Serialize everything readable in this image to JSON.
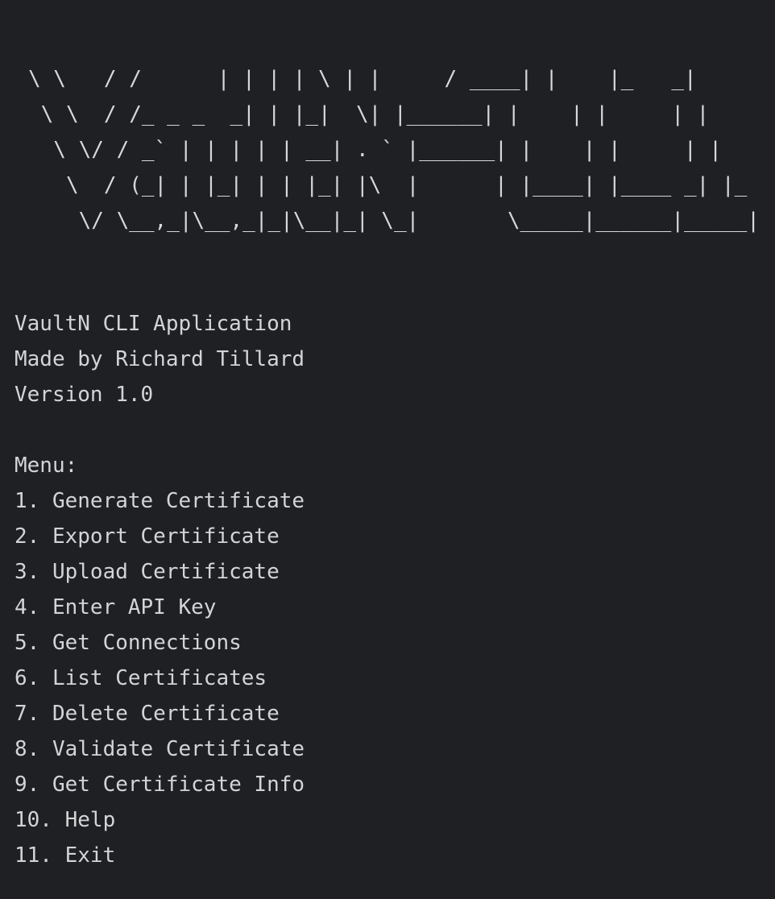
{
  "banner": {
    "lines": [
      "\\ \\   / /      | | | | \\ | |     / ____| |    |_   _|",
      " \\ \\  / /_ _ _  _| | |_|  \\| |______| |    | |     | |",
      "  \\ \\/ / _` | | | | | __| . ` |______| |    | |     | |",
      "   \\  / (_| | |_| | | |_| |\\  |      | |____| |____ _| |_",
      "    \\/ \\__,_|\\__,_|_|\\__|_| \\_|       \\_____|______|_____|"
    ]
  },
  "app": {
    "name": "VaultN CLI Application",
    "author": "Made by Richard Tillard",
    "version": "Version 1.0"
  },
  "menu": {
    "title": "Menu:",
    "items": [
      "1. Generate Certificate",
      "2. Export Certificate",
      "3. Upload Certificate",
      "4. Enter API Key",
      "5. Get Connections",
      "6. List Certificates",
      "7. Delete Certificate",
      "8. Validate Certificate",
      "9. Get Certificate Info",
      "10. Help",
      "11. Exit"
    ]
  },
  "colors": {
    "background": "#1f2023",
    "text": "#d3d4d6"
  }
}
